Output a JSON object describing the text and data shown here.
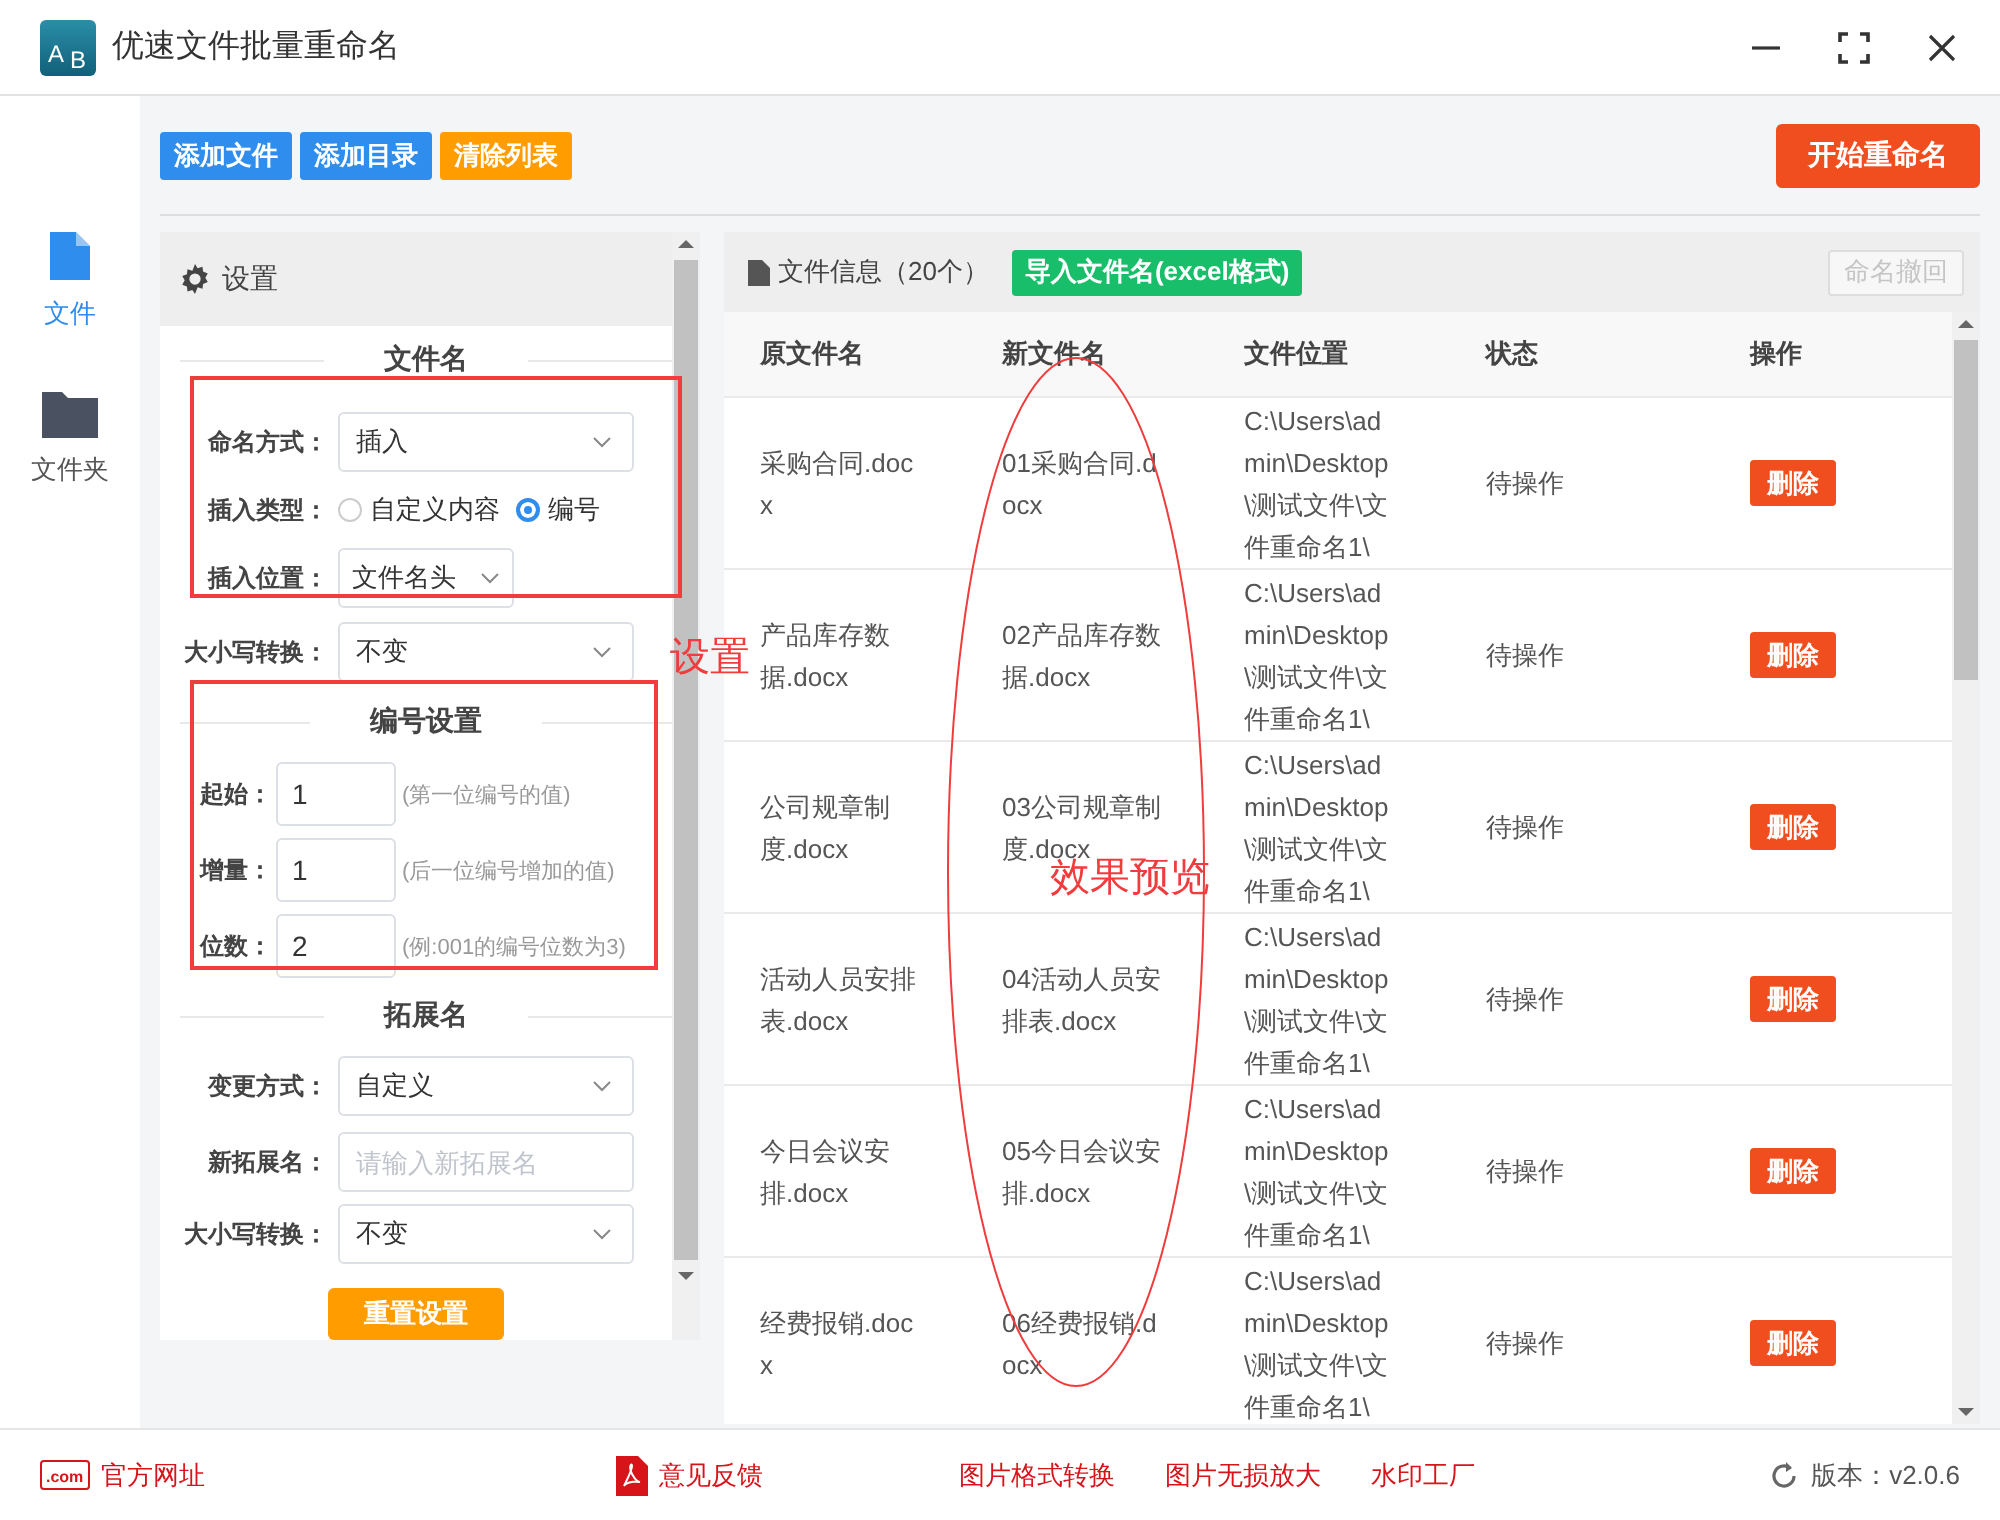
{
  "window": {
    "title": "优速文件批量重命名",
    "logo_letters": [
      "A",
      "B"
    ]
  },
  "sidebar": [
    {
      "label": "文件",
      "selected": true
    },
    {
      "label": "文件夹",
      "selected": false
    }
  ],
  "toolbar": {
    "buttons": [
      {
        "label": "添加文件",
        "kind": "primary"
      },
      {
        "label": "添加目录",
        "kind": "primary"
      },
      {
        "label": "清除列表",
        "kind": "warning"
      }
    ],
    "start": "开始重命名"
  },
  "settings": {
    "title": "设置",
    "filename": {
      "heading": "文件名",
      "naming_mode": {
        "label": "命名方式：",
        "value": "插入"
      },
      "insert_type": {
        "label": "插入类型：",
        "options": [
          {
            "label": "自定义内容",
            "selected": false
          },
          {
            "label": "编号",
            "selected": true
          }
        ]
      },
      "insert_position": {
        "label": "插入位置：",
        "value": "文件名头"
      },
      "case": {
        "label": "大小写转换：",
        "value": "不变"
      }
    },
    "numbering": {
      "heading": "编号设置",
      "fields": [
        {
          "label": "起始：",
          "value": "1",
          "hint": "(第一位编号的值)"
        },
        {
          "label": "增量：",
          "value": "1",
          "hint": "(后一位编号增加的值)"
        },
        {
          "label": "位数：",
          "value": "2",
          "hint": "(例:001的编号位数为3)"
        }
      ]
    },
    "extension": {
      "heading": "拓展名",
      "change_mode": {
        "label": "变更方式：",
        "value": "自定义"
      },
      "new_extension": {
        "label": "新拓展名：",
        "placeholder": "请输入新拓展名"
      },
      "case": {
        "label": "大小写转换：",
        "value": "不变"
      }
    },
    "reset": "重置设置"
  },
  "files": {
    "title": "文件信息（20个）",
    "import": "导入文件名(excel格式)",
    "undo": {
      "label": "命名撤回",
      "disabled": true
    },
    "columns": [
      "原文件名",
      "新文件名",
      "文件位置",
      "状态",
      "操作"
    ],
    "rows": [
      {
        "original": "采购合同.docx",
        "new": "01采购合同.docx",
        "location": "C:\\Users\\admin\\Desktop\\测试文件\\文件重命名1\\",
        "status": "待操作",
        "action": "删除"
      },
      {
        "original": "产品库存数据.docx",
        "new": "02产品库存数据.docx",
        "location": "C:\\Users\\admin\\Desktop\\测试文件\\文件重命名1\\",
        "status": "待操作",
        "action": "删除"
      },
      {
        "original": "公司规章制度.docx",
        "new": "03公司规章制度.docx",
        "location": "C:\\Users\\admin\\Desktop\\测试文件\\文件重命名1\\",
        "status": "待操作",
        "action": "删除"
      },
      {
        "original": "活动人员安排表.docx",
        "new": "04活动人员安排表.docx",
        "location": "C:\\Users\\admin\\Desktop\\测试文件\\文件重命名1\\",
        "status": "待操作",
        "action": "删除"
      },
      {
        "original": "今日会议安排.docx",
        "new": "05今日会议安排.docx",
        "location": "C:\\Users\\admin\\Desktop\\测试文件\\文件重命名1\\",
        "status": "待操作",
        "action": "删除"
      },
      {
        "original": "经费报销.docx",
        "new": "06经费报销.docx",
        "location": "C:\\Users\\admin\\Desktop\\测试文件\\文件重命名1\\",
        "status": "待操作",
        "action": "删除"
      }
    ]
  },
  "footer": {
    "links": [
      {
        "label": "官方网址",
        "kind": "website",
        "icon_text": ".com"
      },
      {
        "label": "意见反馈",
        "kind": "pdf"
      },
      {
        "label": "图片格式转换",
        "kind": "plain"
      },
      {
        "label": "图片无损放大",
        "kind": "plain"
      },
      {
        "label": "水印工厂",
        "kind": "plain"
      }
    ],
    "version": "版本：v2.0.6"
  },
  "annotations": [
    {
      "text": "设置",
      "kind": "settings"
    },
    {
      "text": "效果预览",
      "kind": "preview"
    }
  ]
}
